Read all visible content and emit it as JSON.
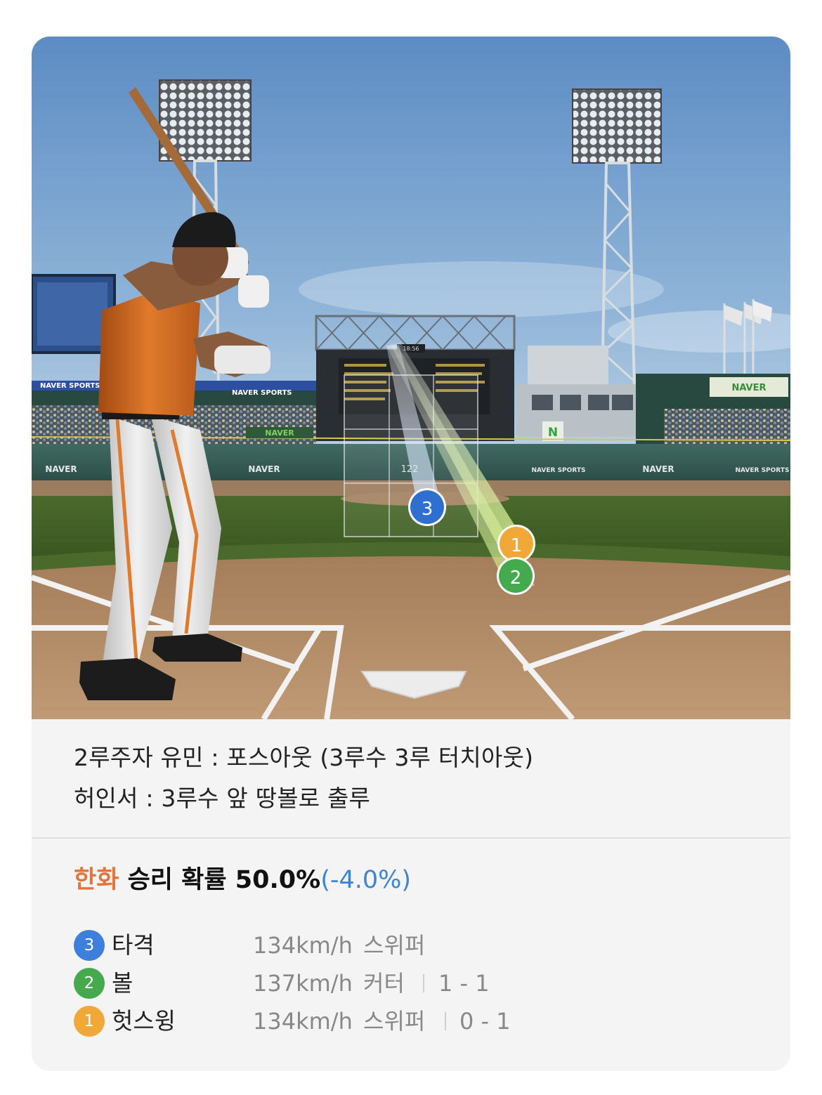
{
  "scene": {
    "ads": {
      "naver": "NAVER",
      "naver_sports": "NAVER SPORTS",
      "n_logo": "N"
    },
    "scoreboard_clock": "18:56",
    "zone_speed": "122",
    "markers": [
      {
        "num": "3",
        "color": "#2f6fd0"
      },
      {
        "num": "1",
        "color": "#f0a838"
      },
      {
        "num": "2",
        "color": "#45a94d"
      }
    ]
  },
  "events": [
    "2루주자 유민 : 포스아웃 (3루수 3루 터치아웃)",
    "허인서 : 3루수 앞 땅볼로 출루"
  ],
  "win_probability": {
    "team": "한화",
    "label": "승리 확률",
    "value": "50.0%",
    "change": "(-4.0%)",
    "team_color": "#e0763b",
    "change_color": "#3d83d6"
  },
  "pitches": [
    {
      "num": "3",
      "color": "#3d7fdc",
      "result": "타격",
      "speed": "134km/h",
      "type": "스위퍼",
      "count": ""
    },
    {
      "num": "2",
      "color": "#45a94d",
      "result": "볼",
      "speed": "137km/h",
      "type": "커터",
      "count": "1 - 1"
    },
    {
      "num": "1",
      "color": "#f0a838",
      "result": "헛스윙",
      "speed": "134km/h",
      "type": "스위퍼",
      "count": "0 - 1"
    }
  ]
}
